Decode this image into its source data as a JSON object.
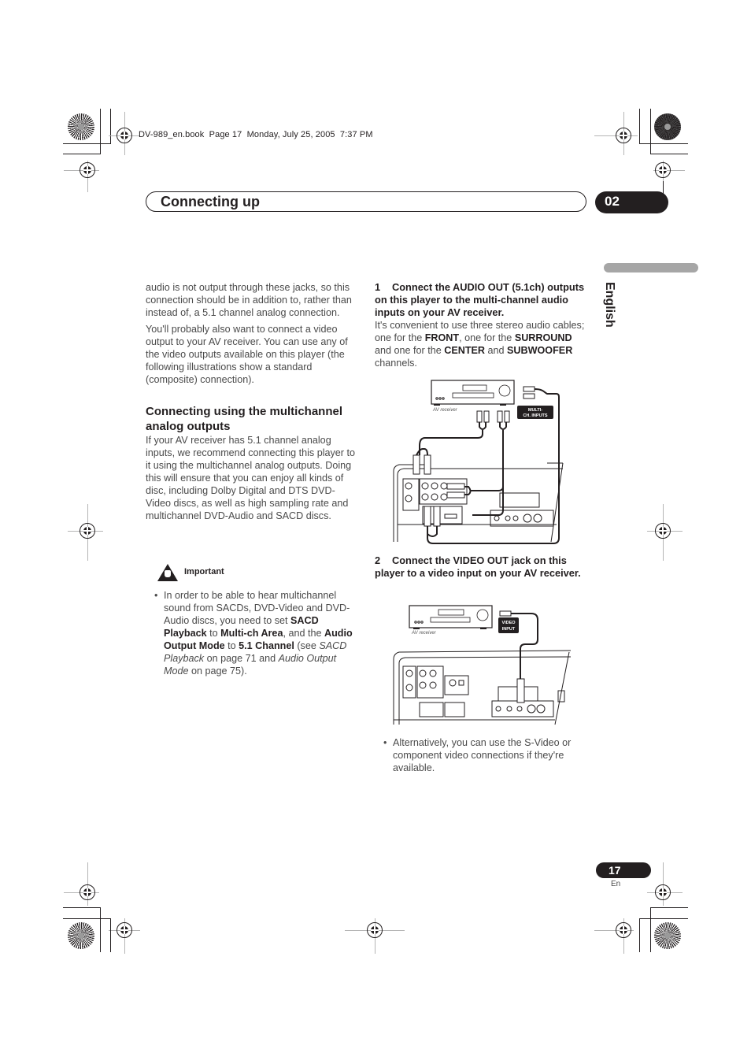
{
  "slug": "DV-989_en.book  Page 17  Monday, July 25, 2005  7:37 PM",
  "header": {
    "section_title": "Connecting up",
    "chapter_number": "02"
  },
  "language_tab": "English",
  "left_column": {
    "para1": "audio is not output through these jacks, so this connection should be in addition to, rather than instead of, a 5.1 channel analog connection.",
    "para2": "You'll probably also want to connect a video output to your AV receiver. You can use any of the video outputs available on this player (the following illustrations show a standard (composite) connection).",
    "subheading": "Connecting using the multichannel analog outputs",
    "para3": "If your AV receiver has 5.1 channel analog inputs, we recommend connecting this player to it using the multichannel analog outputs. Doing this will ensure that you can enjoy all kinds of disc, including Dolby Digital and DTS DVD-Video discs, as well as high sampling rate and multichannel DVD-Audio and SACD discs.",
    "important_label": "Important",
    "important_bullet": {
      "t1": "In order to be able to hear multichannel sound from SACDs, DVD-Video and DVD-Audio discs, you need to set ",
      "b1": "SACD Playback",
      "t2": " to ",
      "b2": "Multi-ch Area",
      "t3": ", and the ",
      "b3": "Audio Output Mode",
      "t4": " to ",
      "b4": "5.1 Channel",
      "t5": " (see ",
      "i1": "SACD Playback",
      "t6": " on page 71 and ",
      "i2": "Audio Output Mode",
      "t7": " on page 75)."
    }
  },
  "right_column": {
    "step1": {
      "number": "1",
      "heading": "Connect the AUDIO OUT (5.1ch) outputs on this player to the multi-channel audio inputs on your AV receiver.",
      "t1": "It's convenient to use three stereo audio cables; one for the ",
      "b1": "FRONT",
      "t2": ", one for the ",
      "b2": "SURROUND",
      "t3": " and one for the ",
      "b3": "CENTER",
      "t4": " and ",
      "b4": "SUBWOOFER",
      "t5": " channels."
    },
    "figure1": {
      "receiver_label": "AV receiver",
      "input_label_line1": "MULTI-",
      "input_label_line2": "CH. INPUTS"
    },
    "step2": {
      "number": "2",
      "heading": "Connect the VIDEO OUT jack on this player to a video input on your AV receiver."
    },
    "figure2": {
      "receiver_label": "AV receiver",
      "input_label_line1": "VIDEO",
      "input_label_line2": "INPUT"
    },
    "note_bullet": "Alternatively, you can use the S-Video or component video connections if they're available."
  },
  "footer": {
    "page_number": "17",
    "language_code": "En"
  }
}
